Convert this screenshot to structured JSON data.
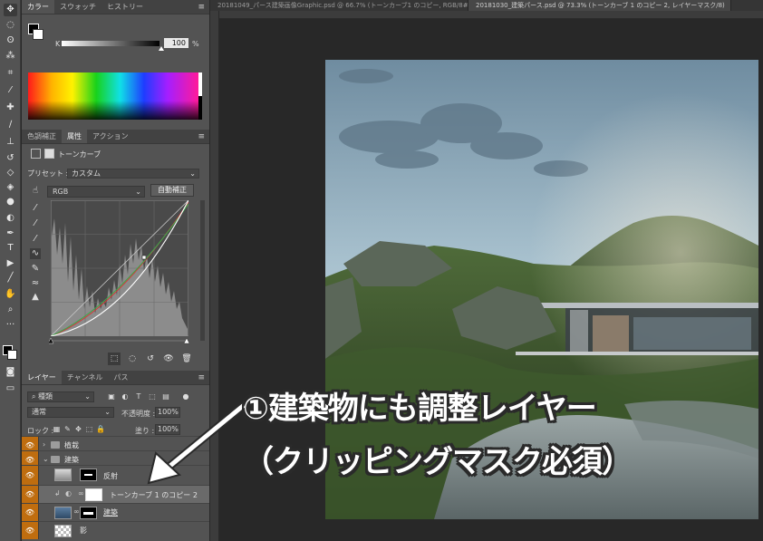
{
  "tools": [
    "move-icon",
    "marquee-icon",
    "lasso-icon",
    "magic-wand-icon",
    "crop-icon",
    "eyedropper-icon",
    "healing-icon",
    "brush-icon",
    "stamp-icon",
    "history-brush-icon",
    "eraser-icon",
    "bucket-icon",
    "blur-icon",
    "dodge-icon",
    "pen-icon",
    "type-icon",
    "path-select-icon",
    "line-icon",
    "hand-icon",
    "zoom-icon"
  ],
  "color_panel": {
    "tabs": [
      "カラー",
      "スウォッチ",
      "ヒストリー"
    ],
    "k_label": "K",
    "k_value": "100",
    "k_unit": "%"
  },
  "properties_panel": {
    "tabs": [
      "色調補正",
      "属性",
      "アクション"
    ],
    "title": "トーンカーブ",
    "preset_label": "プリセット :",
    "preset_value": "カスタム",
    "channel": "RGB",
    "auto_button": "自動補正"
  },
  "layers_panel": {
    "tabs": [
      "レイヤー",
      "チャンネル",
      "パス"
    ],
    "filter": "種類",
    "blend_mode": "通常",
    "opacity_label": "不透明度 :",
    "opacity_value": "100%",
    "lock_label": "ロック :",
    "fill_label": "塗り :",
    "fill_value": "100%",
    "layers": [
      {
        "name": "植栽"
      },
      {
        "name": "建築"
      },
      {
        "name": "反射"
      },
      {
        "name": "トーンカーブ 1 のコピー 2"
      },
      {
        "name": "建築"
      },
      {
        "name": "影"
      }
    ]
  },
  "document_tabs": [
    "20181049_パース建築画像Graphic.psd @ 66.7% (トーンカーブ1 のコピー, RGB/8#)",
    "20181030_建築パース.psd @ 73.3% (トーンカーブ 1 のコピー 2, レイヤーマスク/8)"
  ],
  "annotation": {
    "line1": "①建築物にも調整レイヤー",
    "line2": "（クリッピングマスク必須）"
  }
}
